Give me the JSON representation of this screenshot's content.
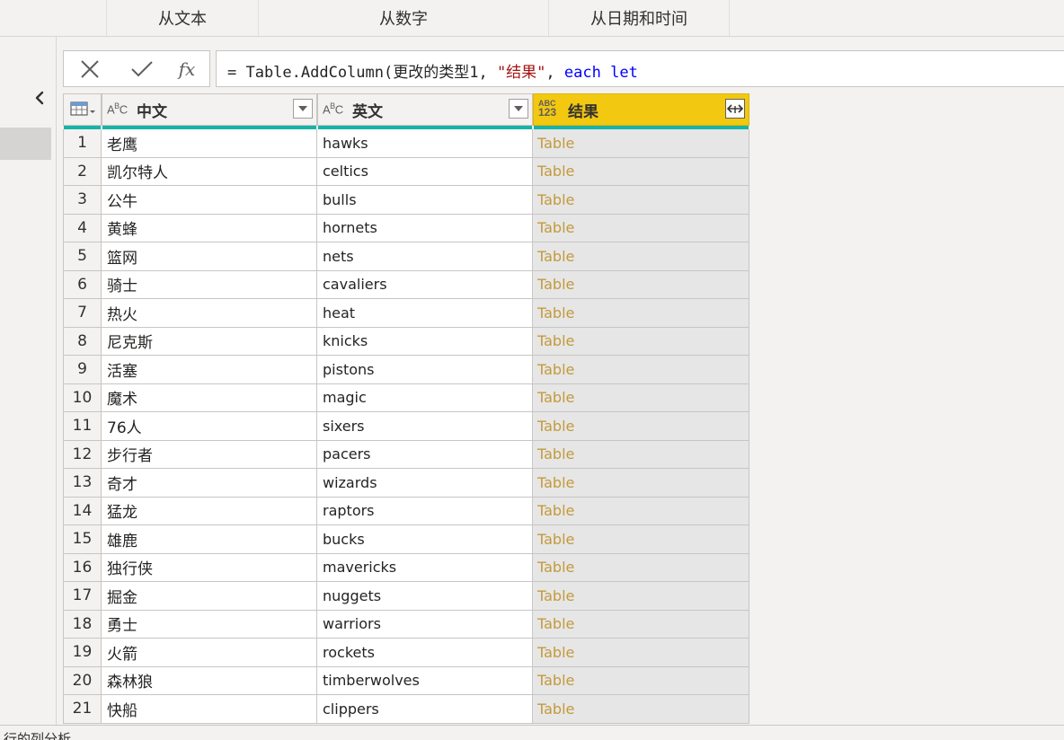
{
  "ribbon": {
    "groups": [
      "",
      "从文本",
      "从数字",
      "从日期和时间"
    ]
  },
  "formula_bar": {
    "cancel_icon": "close-icon",
    "commit_icon": "check-icon",
    "fx_label": "fx",
    "formula_prefix": "= Table.AddColumn(更改的类型1, ",
    "formula_string": "\"结果\"",
    "formula_sep": ", ",
    "formula_kw1": "each",
    "formula_space": " ",
    "formula_kw2": "let"
  },
  "grid": {
    "columns": [
      {
        "type_icon": "ABC",
        "name": "中文"
      },
      {
        "type_icon": "ABC",
        "name": "英文"
      },
      {
        "type_icon": "ABC123",
        "name": "结果"
      }
    ],
    "rows": [
      {
        "n": "1",
        "cn": "老鹰",
        "en": "hawks",
        "res": "Table"
      },
      {
        "n": "2",
        "cn": "凯尔特人",
        "en": "celtics",
        "res": "Table"
      },
      {
        "n": "3",
        "cn": "公牛",
        "en": "bulls",
        "res": "Table"
      },
      {
        "n": "4",
        "cn": "黄蜂",
        "en": "hornets",
        "res": "Table"
      },
      {
        "n": "5",
        "cn": "篮网",
        "en": "nets",
        "res": "Table"
      },
      {
        "n": "6",
        "cn": "骑士",
        "en": "cavaliers",
        "res": "Table"
      },
      {
        "n": "7",
        "cn": "热火",
        "en": "heat",
        "res": "Table"
      },
      {
        "n": "8",
        "cn": "尼克斯",
        "en": "knicks",
        "res": "Table"
      },
      {
        "n": "9",
        "cn": "活塞",
        "en": "pistons",
        "res": "Table"
      },
      {
        "n": "10",
        "cn": "魔术",
        "en": "magic",
        "res": "Table"
      },
      {
        "n": "11",
        "cn": "76人",
        "en": "sixers",
        "res": "Table"
      },
      {
        "n": "12",
        "cn": "步行者",
        "en": "pacers",
        "res": "Table"
      },
      {
        "n": "13",
        "cn": "奇才",
        "en": "wizards",
        "res": "Table"
      },
      {
        "n": "14",
        "cn": "猛龙",
        "en": "raptors",
        "res": "Table"
      },
      {
        "n": "15",
        "cn": "雄鹿",
        "en": "bucks",
        "res": "Table"
      },
      {
        "n": "16",
        "cn": "独行侠",
        "en": "mavericks",
        "res": "Table"
      },
      {
        "n": "17",
        "cn": "掘金",
        "en": "nuggets",
        "res": "Table"
      },
      {
        "n": "18",
        "cn": "勇士",
        "en": "warriors",
        "res": "Table"
      },
      {
        "n": "19",
        "cn": "火箭",
        "en": "rockets",
        "res": "Table"
      },
      {
        "n": "20",
        "cn": "森林狼",
        "en": "timberwolves",
        "res": "Table"
      },
      {
        "n": "21",
        "cn": "快船",
        "en": "clippers",
        "res": "Table"
      }
    ]
  },
  "status_bar": {
    "text": "行的列分析"
  },
  "colors": {
    "selected_column_header": "#f2c811",
    "column_quality_bar": "#17b3a6",
    "table_link_text": "#c49a3a"
  }
}
